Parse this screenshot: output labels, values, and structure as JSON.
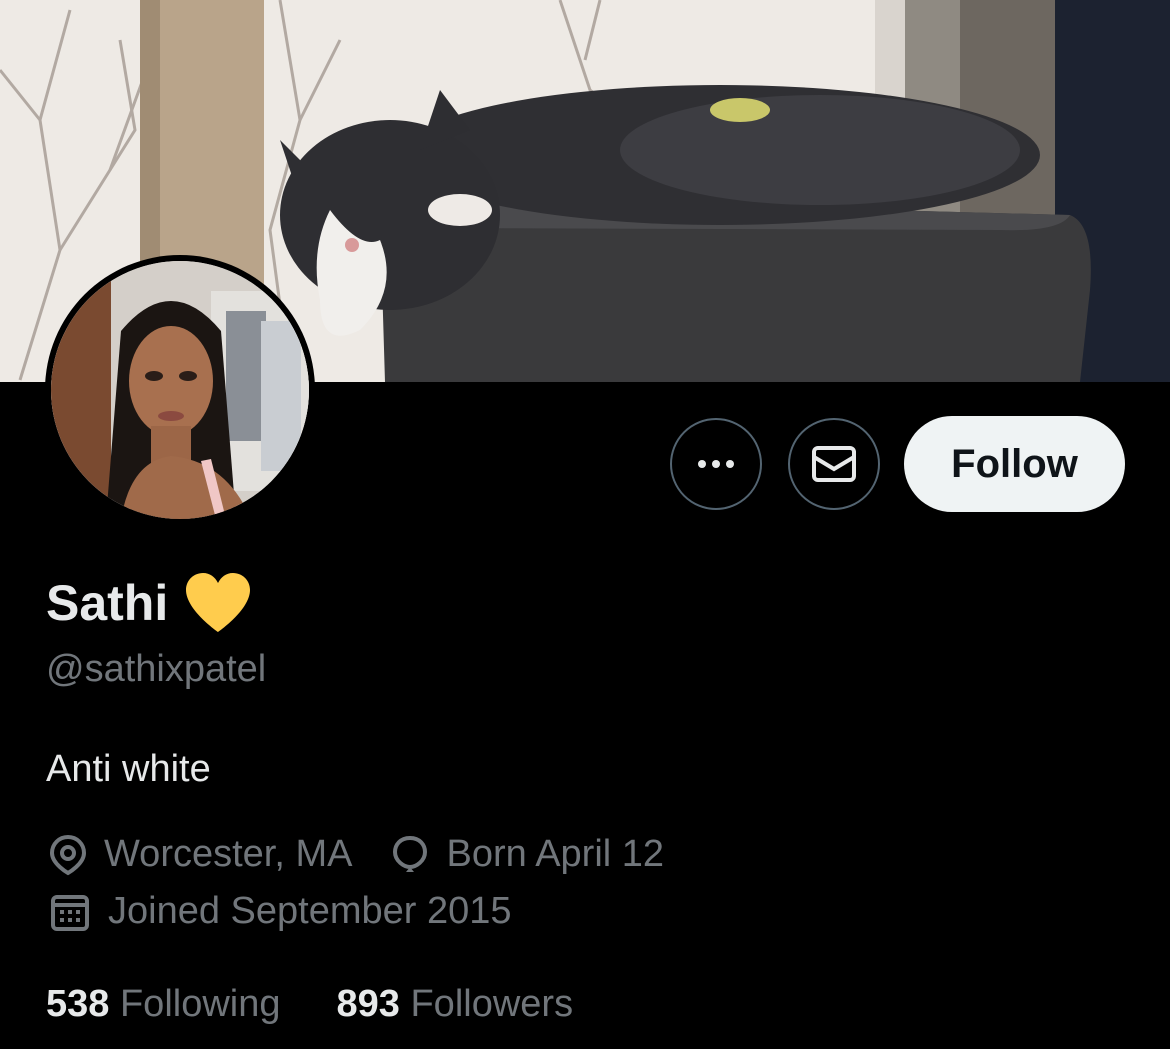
{
  "profile": {
    "display_name": "Sathi",
    "name_emoji": "yellow-heart",
    "handle": "@sathixpatel",
    "bio": "Anti white",
    "location": "Worcester, MA",
    "birthday": "Born April 12",
    "joined": "Joined September 2015"
  },
  "stats": {
    "following_count": "538",
    "following_label": "Following",
    "followers_count": "893",
    "followers_label": "Followers"
  },
  "actions": {
    "more_icon": "more-icon",
    "message_icon": "envelope-icon",
    "follow_label": "Follow"
  },
  "colors": {
    "background": "#000000",
    "primary_text": "#e7e9ea",
    "secondary_text": "#71767b",
    "button_border": "#536471",
    "follow_bg": "#eff3f4",
    "heart": "#ffcc4d"
  }
}
